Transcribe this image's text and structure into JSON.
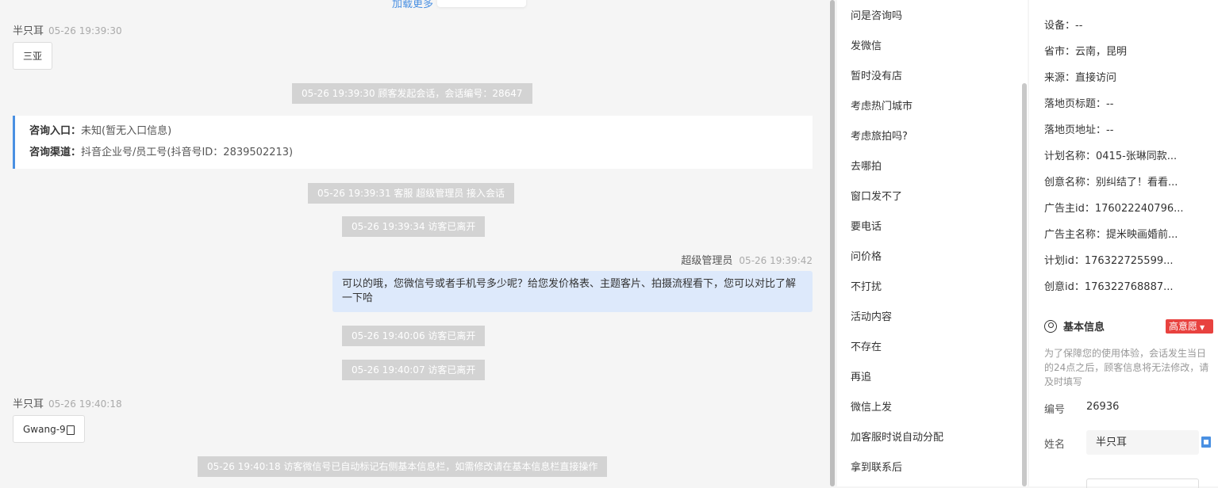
{
  "chat": {
    "load_more": "加载更多",
    "m1": {
      "sender": "半只耳",
      "time": "05-26 19:39:30",
      "text": "三亚"
    },
    "sys1": "05-26 19:39:30 顾客发起会话，会话编号：28647",
    "entry_label": "咨询入口：",
    "entry_value": "未知(暂无入口信息)",
    "channel_label": "咨询渠道：",
    "channel_value": "抖音企业号/员工号(抖音号ID：2839502213)",
    "sys2": "05-26 19:39:31 客服 超级管理员 接入会话",
    "sys3": "05-26 19:39:34 访客已离开",
    "agent": {
      "name": "超级管理员",
      "time": "05-26 19:39:42",
      "text": "可以的哦，您微信号或者手机号多少呢？给您发价格表、主题客片、拍摄流程看下，您可以对比了解一下哈"
    },
    "sys4": "05-26 19:40:06 访客已离开",
    "sys5": "05-26 19:40:07 访客已离开",
    "m2": {
      "sender": "半只耳",
      "time": "05-26 19:40:18",
      "text": "Gwang-9"
    },
    "sys6": "05-26 19:40:18 访客微信号已自动标记右侧基本信息栏，如需修改请在基本信息栏直接操作"
  },
  "quick_replies": [
    "问是咨询吗",
    "发微信",
    "暂时没有店",
    "考虑热门城市",
    "考虑旅拍吗?",
    "去哪拍",
    "窗口发不了",
    "要电话",
    "问价格",
    "不打扰",
    "活动内容",
    "不存在",
    "再追",
    "微信上发",
    "加客服时说自动分配",
    "拿到联系后"
  ],
  "side": {
    "device": "设备：--",
    "province": "省市：云南，昆明",
    "source": "来源：直接访问",
    "landing_title": "落地页标题：--",
    "landing_url": "落地页地址：--",
    "plan_name": "计划名称：0415-张琳同款...",
    "creative_name": "创意名称：别纠结了！看看...",
    "advertiser_id": "广告主id：176022240796...",
    "advertiser_name": "广告主名称：提米映画婚前...",
    "plan_id": "计划id：176322725599...",
    "creative_id": "创意id：176322768887...",
    "basic_title": "基本信息",
    "intent": "高意愿",
    "notice": "为了保障您的使用体验，会话发生当日的24点之后，顾客信息将无法修改，请及时填写",
    "number_label": "编号",
    "number_value": "26936",
    "name_label": "姓名",
    "name_value": "半只耳"
  },
  "colors": {
    "accent": "#4a90e2",
    "intent_red": "#e8423f",
    "agent_bubble": "#dde9fb",
    "system_bg": "#d3d3d3"
  }
}
